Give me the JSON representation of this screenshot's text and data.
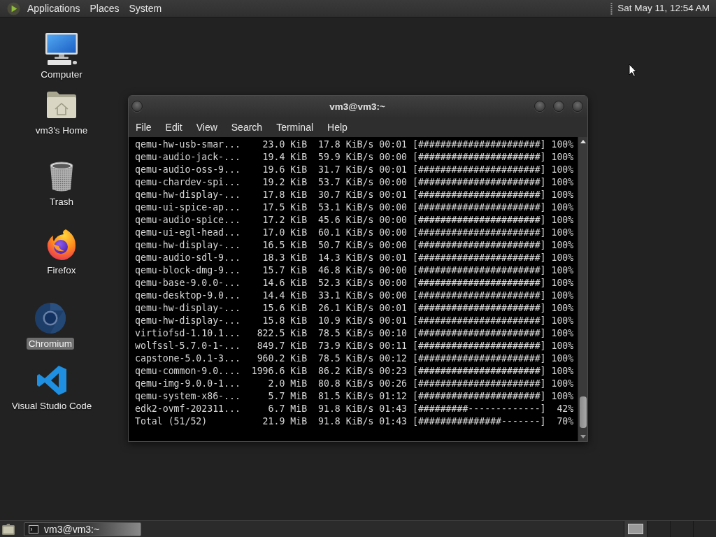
{
  "top_panel": {
    "menus": [
      "Applications",
      "Places",
      "System"
    ],
    "clock": "Sat May 11, 12:54 AM"
  },
  "desktop_icons": [
    {
      "kind": "computer",
      "label": "Computer",
      "selected": false
    },
    {
      "kind": "home",
      "label": "vm3's Home",
      "selected": false
    },
    {
      "kind": "trash",
      "label": "Trash",
      "selected": false
    },
    {
      "kind": "firefox",
      "label": "Firefox",
      "selected": false
    },
    {
      "kind": "chromium",
      "label": "Chromium",
      "selected": true
    },
    {
      "kind": "vscode",
      "label": "Visual Studio Code",
      "selected": false
    }
  ],
  "terminal": {
    "title": "vm3@vm3:~",
    "menu": [
      "File",
      "Edit",
      "View",
      "Search",
      "Terminal",
      "Help"
    ],
    "lines": [
      "qemu-hw-usb-smar...    23.0 KiB  17.8 KiB/s 00:01 [######################] 100%",
      "qemu-audio-jack-...    19.4 KiB  59.9 KiB/s 00:00 [######################] 100%",
      "qemu-audio-oss-9...    19.6 KiB  31.7 KiB/s 00:01 [######################] 100%",
      "qemu-chardev-spi...    19.2 KiB  53.7 KiB/s 00:00 [######################] 100%",
      "qemu-hw-display-...    17.8 KiB  30.7 KiB/s 00:01 [######################] 100%",
      "qemu-ui-spice-ap...    17.5 KiB  53.1 KiB/s 00:00 [######################] 100%",
      "qemu-audio-spice...    17.2 KiB  45.6 KiB/s 00:00 [######################] 100%",
      "qemu-ui-egl-head...    17.0 KiB  60.1 KiB/s 00:00 [######################] 100%",
      "qemu-hw-display-...    16.5 KiB  50.7 KiB/s 00:00 [######################] 100%",
      "qemu-audio-sdl-9...    18.3 KiB  14.3 KiB/s 00:01 [######################] 100%",
      "qemu-block-dmg-9...    15.7 KiB  46.8 KiB/s 00:00 [######################] 100%",
      "qemu-base-9.0.0-...    14.6 KiB  52.3 KiB/s 00:00 [######################] 100%",
      "qemu-desktop-9.0...    14.4 KiB  33.1 KiB/s 00:00 [######################] 100%",
      "qemu-hw-display-...    15.6 KiB  26.1 KiB/s 00:01 [######################] 100%",
      "qemu-hw-display-...    15.8 KiB  10.9 KiB/s 00:01 [######################] 100%",
      "virtiofsd-1.10.1...   822.5 KiB  78.5 KiB/s 00:10 [######################] 100%",
      "wolfssl-5.7.0-1-...   849.7 KiB  73.9 KiB/s 00:11 [######################] 100%",
      "capstone-5.0.1-3...   960.2 KiB  78.5 KiB/s 00:12 [######################] 100%",
      "qemu-common-9.0....  1996.6 KiB  86.2 KiB/s 00:23 [######################] 100%",
      "qemu-img-9.0.0-1...     2.0 MiB  80.8 KiB/s 00:26 [######################] 100%",
      "qemu-system-x86-...     5.7 MiB  81.5 KiB/s 01:12 [######################] 100%",
      "edk2-ovmf-202311...     6.7 MiB  91.8 KiB/s 01:43 [#########-------------]  42%",
      "Total (51/52)          21.9 MiB  91.8 KiB/s 01:43 [###############-------]  70%"
    ]
  },
  "taskbar": {
    "tasks": [
      {
        "label": "vm3@vm3:~",
        "selected": true
      }
    ],
    "workspaces": [
      {
        "selected": true
      },
      {
        "selected": false
      },
      {
        "selected": false
      },
      {
        "selected": false
      }
    ]
  }
}
